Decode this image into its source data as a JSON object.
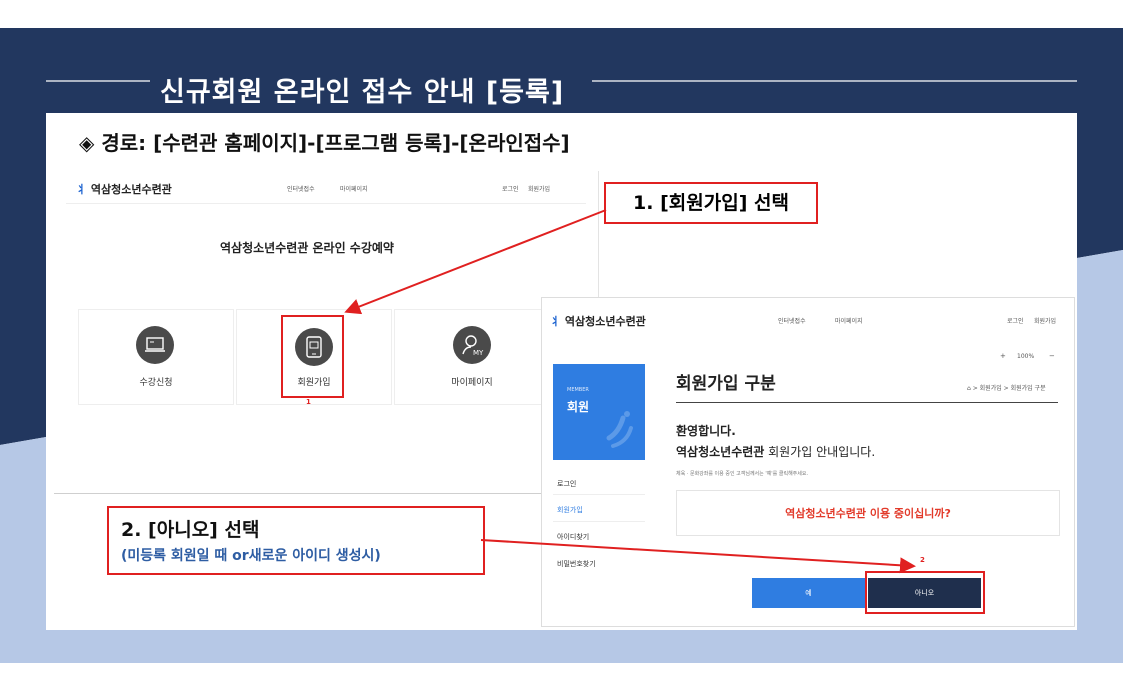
{
  "slide": {
    "title": "신규회원 온라인 접수 안내 [등록]",
    "path_symbol": "◈",
    "path_text": "경로: [수련관 홈페이지]-[프로그램 등록]-[온라인접수]",
    "colors": {
      "navy": "#22375f",
      "light_blue": "#b6c8e6",
      "red": "#e02020",
      "accent_blue": "#2f7de1"
    }
  },
  "shot1": {
    "logo_mark": "⺦",
    "logo_text": "역삼청소년수련관",
    "nav": [
      "인터넷접수",
      "마이페이지"
    ],
    "util": [
      "로그인",
      "회원가입"
    ],
    "heading": "역삼청소년수련관 온라인 수강예약",
    "cards": [
      {
        "label": "수강신청",
        "icon": "laptop-icon"
      },
      {
        "label": "회원가입",
        "icon": "tablet-icon"
      },
      {
        "label": "마이페이지",
        "icon": "user-my-icon"
      }
    ],
    "marker": "1"
  },
  "callout1": "1. [회원가입] 선택",
  "callout2": {
    "line1": "2. [아니오] 선택",
    "line2": "(미등록 회원일 때 or새로운 아이디 생성시)"
  },
  "shot2": {
    "logo_mark": "⺦",
    "logo_text": "역삼청소년수련관",
    "nav": [
      "인터넷접수",
      "마이페이지"
    ],
    "util": [
      "로그인",
      "회원가입"
    ],
    "zoom_plus": "+",
    "zoom_level": "100%",
    "zoom_minus": "−",
    "member_small": "MEMBER",
    "member_big": "회원",
    "side_menu": [
      "로그인",
      "회원가입",
      "아이디찾기",
      "비밀번호찾기"
    ],
    "page_title": "회원가입 구분",
    "breadcrumb": "⌂ > 회원가입 > 회원가입 구분",
    "welcome": "환영합니다.",
    "guide_bold": "역삼청소년수련관",
    "guide_rest": " 회원가입 안내입니다.",
    "note": "체육 · 문화강좌를 이용 중인 고객님께서는 '예'를 클릭해주세요.",
    "question": "역삼청소년수련관 이용 중이십니까?",
    "marker": "2",
    "btn_yes": "예",
    "btn_no": "아니오"
  }
}
